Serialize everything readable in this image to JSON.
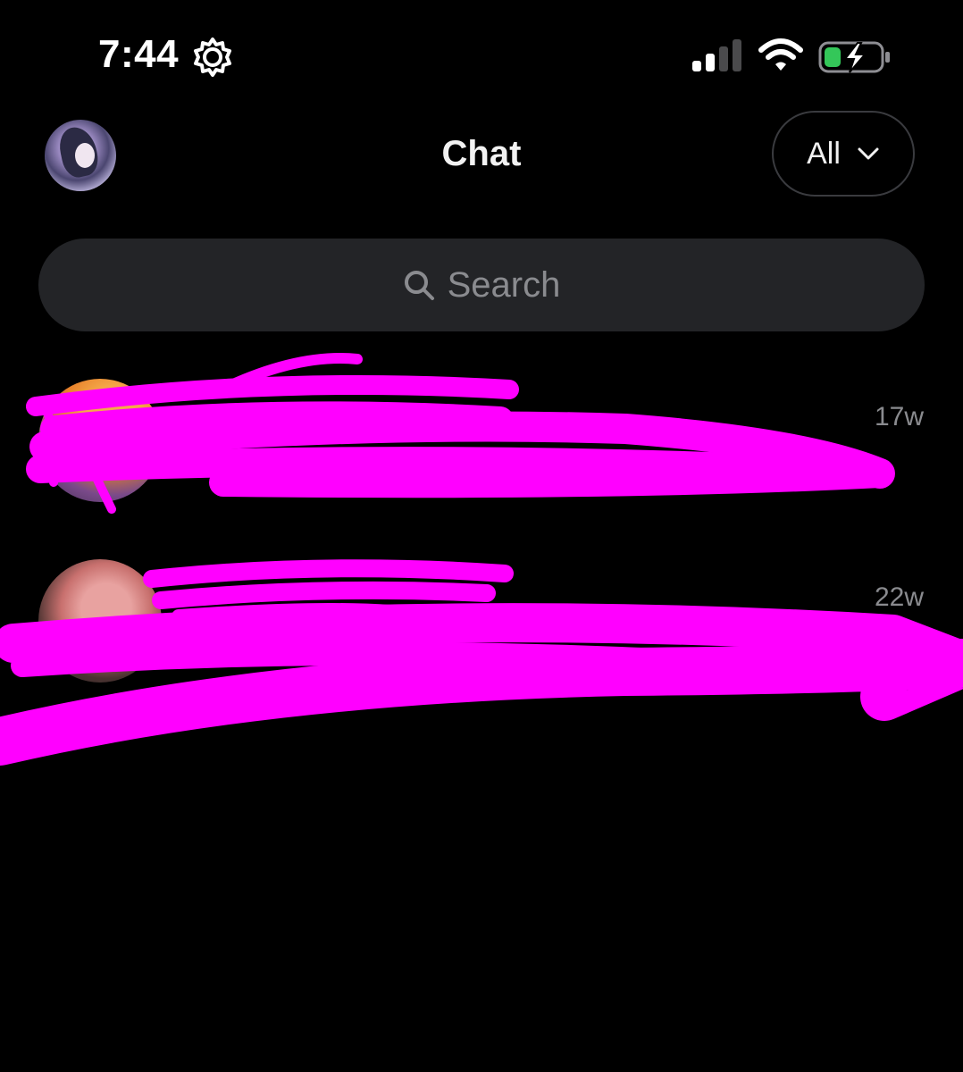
{
  "status_bar": {
    "time": "7:44",
    "icons": [
      "gear-icon",
      "signal-icon",
      "wifi-icon",
      "battery-charging-icon"
    ]
  },
  "header": {
    "title": "Chat",
    "filter_label": "All",
    "filter_icon": "chevron-down-icon"
  },
  "search": {
    "placeholder": "Search",
    "icon": "search-icon"
  },
  "chats": [
    {
      "time": "17w"
    },
    {
      "time": "22w"
    }
  ],
  "colors": {
    "background": "#000000",
    "search_bg": "#232427",
    "muted_text": "#8a8b8f",
    "redaction": "#ff00ff",
    "battery_fill": "#34c759"
  }
}
